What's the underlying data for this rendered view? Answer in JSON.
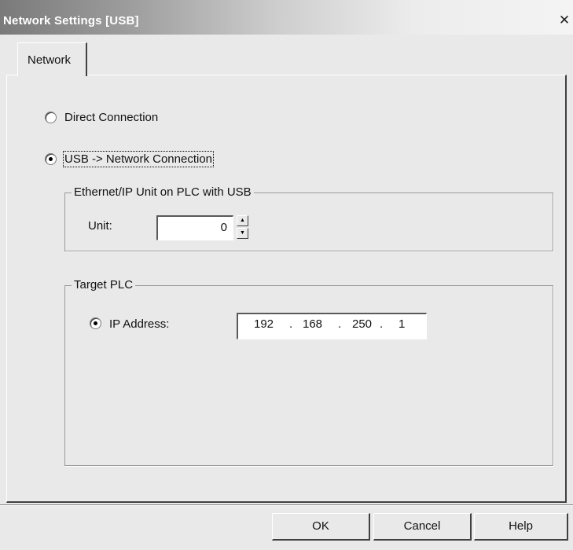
{
  "window": {
    "title": "Network Settings [USB]",
    "close_glyph": "✕"
  },
  "tabs": [
    {
      "label": "Network",
      "selected": true
    }
  ],
  "connection": {
    "options": [
      {
        "label": "Direct Connection",
        "selected": false
      },
      {
        "label": "USB -> Network Connection",
        "selected": true
      }
    ]
  },
  "ethernet_group": {
    "legend": "Ethernet/IP Unit on PLC with USB",
    "unit_label": "Unit:",
    "unit_value": "0",
    "spin_up": "▲",
    "spin_down": "▼"
  },
  "target_group": {
    "legend": "Target PLC",
    "ip_option_label": "IP Address:",
    "ip_selected": true,
    "ip_octets": [
      "192",
      "168",
      "250",
      "1"
    ],
    "ip_dot": "."
  },
  "buttons": {
    "ok": "OK",
    "cancel": "Cancel",
    "help": "Help"
  }
}
